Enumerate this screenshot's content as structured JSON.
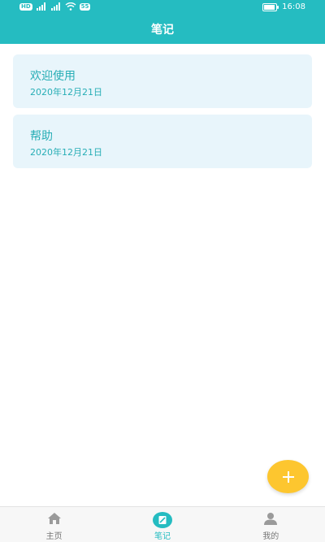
{
  "status_bar": {
    "left_badges": [
      "HD",
      "5G",
      "4G"
    ],
    "nfc_label": "55",
    "time": "16:08"
  },
  "header": {
    "title": "笔记"
  },
  "notes": [
    {
      "title": "欢迎使用",
      "date": "2020年12月21日"
    },
    {
      "title": "帮助",
      "date": "2020年12月21日"
    }
  ],
  "fab": {
    "icon": "plus-icon"
  },
  "bottom_nav": {
    "items": [
      {
        "label": "主页",
        "icon": "home-icon",
        "active": false
      },
      {
        "label": "笔记",
        "icon": "note-icon",
        "active": true
      },
      {
        "label": "我的",
        "icon": "user-icon",
        "active": false
      }
    ]
  },
  "colors": {
    "primary": "#25bcc1",
    "card_bg": "#e8f5fb",
    "fab": "#fdc62f"
  }
}
